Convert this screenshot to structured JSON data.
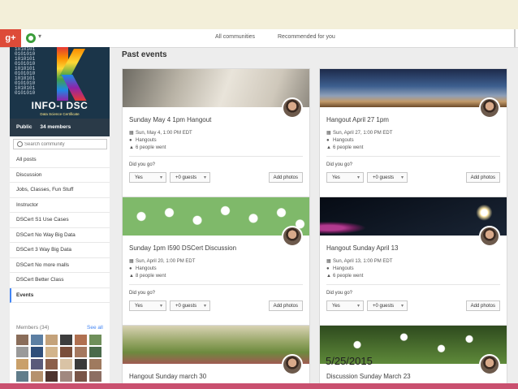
{
  "topbar": {
    "logo": "g+",
    "links": [
      "All communities",
      "Recommended for you"
    ]
  },
  "community": {
    "binary": "1010101\n0101010\n1010101\n0101010\n1010101\n0101010\n1010101\n0101010\n1010101\n0101010",
    "name": "INFO-I DSC",
    "subtitle": "Data Science Certificate",
    "visibility": "Public",
    "members": "34 members",
    "search_placeholder": "Search community"
  },
  "nav": [
    "All posts",
    "Discussion",
    "Jobs, Classes, Fun Stuff",
    "Instructor",
    "DSCert S1 Use Cases",
    "DSCert No Way Big Data",
    "DSCert 3 Way Big Data",
    "DSCert No more malls",
    "DSCert Better Class",
    "Events"
  ],
  "members_section": {
    "label": "Members (34)",
    "see_all": "See all"
  },
  "main": {
    "title": "Past events"
  },
  "events": [
    {
      "title": "Sunday May 4 1pm Hangout",
      "date": "Sun, May 4, 1:00 PM EDT",
      "place": "Hangouts",
      "went": "6 people went",
      "question": "Did you go?",
      "rsvp": "Yes",
      "guests": "+0 guests",
      "add": "Add photos"
    },
    {
      "title": "Hangout April 27 1pm",
      "date": "Sun, April 27, 1:00 PM EDT",
      "place": "Hangouts",
      "went": "6 people went",
      "question": "Did you go?",
      "rsvp": "Yes",
      "guests": "+0 guests",
      "add": "Add photos"
    },
    {
      "title": "Sunday 1pm I590 DSCert Discussion",
      "date": "Sun, April 20, 1:00 PM EDT",
      "place": "Hangouts",
      "went": "8 people went",
      "question": "Did you go?",
      "rsvp": "Yes",
      "guests": "+0 guests",
      "add": "Add photos"
    },
    {
      "title": "Hangout Sunday April 13",
      "date": "Sun, April 13, 1:00 PM EDT",
      "place": "Hangouts",
      "went": "6 people went",
      "question": "Did you go?",
      "rsvp": "Yes",
      "guests": "+0 guests",
      "add": "Add photos"
    },
    {
      "title": "Hangout Sunday march 30"
    },
    {
      "title": "Discussion Sunday March 23"
    }
  ],
  "stamp": "5/25/2015"
}
